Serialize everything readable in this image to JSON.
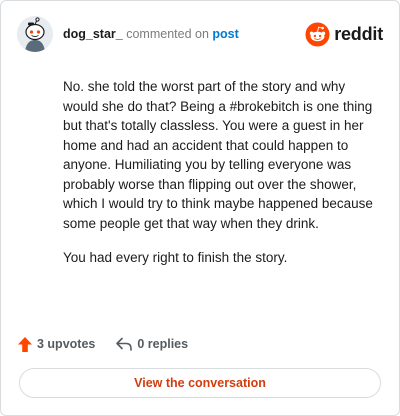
{
  "comment": {
    "username": "dog_star_",
    "commented_on": "commented on",
    "post_link": "post",
    "paragraphs": [
      "No. she told the worst part of the story and why would she do that? Being a #brokebitch is one thing but that's totally classless. You were a guest in her home and had an accident that could happen to anyone. Humiliating you by telling everyone was probably worse than flipping out over the shower, which I would try to think maybe happened because some people get that way when they drink.",
      "You had every right to finish the story."
    ]
  },
  "brand": {
    "wordmark": "reddit",
    "icon": "reddit-logo-icon",
    "color": "#ff4500"
  },
  "actions": {
    "upvotes_label": "3 upvotes",
    "upvote_icon": "upvote-arrow-icon",
    "replies_label": "0 replies",
    "reply_icon": "reply-arrow-icon"
  },
  "cta": {
    "label": "View the conversation"
  },
  "colors": {
    "link_blue": "#0079d3",
    "upvote_orange": "#ff4500",
    "cta_text": "#d23c0f"
  }
}
